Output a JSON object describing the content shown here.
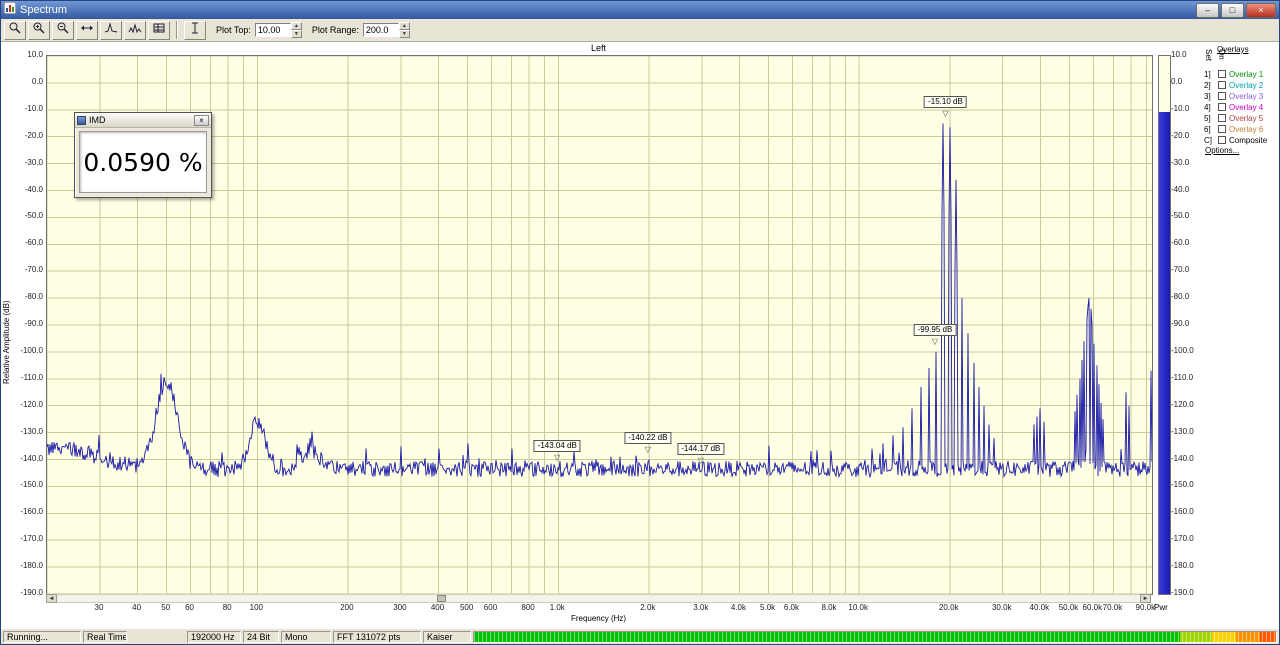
{
  "window": {
    "title": "Spectrum"
  },
  "toolbar": {
    "plot_top_label": "Plot Top:",
    "plot_top_value": "10.00",
    "plot_range_label": "Plot Range:",
    "plot_range_value": "200.0"
  },
  "imd_window": {
    "title": "IMD",
    "value": "0.0590 %"
  },
  "overlays_panel": {
    "title": "Overlays",
    "col_set": "Set",
    "col_on": "On",
    "options_label": "Options...",
    "rows": [
      {
        "num": "1]",
        "label": "Overlay 1",
        "color": "#009000"
      },
      {
        "num": "2]",
        "label": "Overlay 2",
        "color": "#00a0b0"
      },
      {
        "num": "3]",
        "label": "Overlay 3",
        "color": "#8a5fd6"
      },
      {
        "num": "4]",
        "label": "Overlay 4",
        "color": "#cc00cc"
      },
      {
        "num": "5]",
        "label": "Overlay 5",
        "color": "#b04040"
      },
      {
        "num": "6]",
        "label": "Overlay 6",
        "color": "#c08030"
      },
      {
        "num": "C]",
        "label": "Composite",
        "color": "#000000"
      }
    ]
  },
  "meter": {
    "label": "Pwr",
    "value_db": -11
  },
  "markers": [
    {
      "label": "-15.10 dB",
      "freq": 19500,
      "db": -15.1
    },
    {
      "label": "-99.95 dB",
      "freq": 18000,
      "db": -99.95
    },
    {
      "label": "-143.04 dB",
      "freq": 1000,
      "db": -143.04
    },
    {
      "label": "-140.22 dB",
      "freq": 2000,
      "db": -140.22
    },
    {
      "label": "-144.17 dB",
      "freq": 3000,
      "db": -144.17
    }
  ],
  "status_bar": {
    "items": [
      "Running...",
      "Real Time",
      "192000 Hz",
      "24 Bit",
      "Mono",
      "FFT 131072 pts",
      "Kaiser"
    ]
  },
  "chart_data": {
    "type": "line",
    "title": "Left",
    "xlabel": "Frequency (Hz)",
    "ylabel": "Relative Amplitude (dB)",
    "xscale": "log",
    "xlim": [
      20,
      94000
    ],
    "ylim": [
      -190,
      10
    ],
    "grid": true,
    "bg_color": "#ffffe4",
    "grid_color": "#c9c99c",
    "trace_color": "#1a1aa8",
    "yticks": [
      10,
      0,
      -10,
      -20,
      -30,
      -40,
      -50,
      -60,
      -70,
      -80,
      -90,
      -100,
      -110,
      -120,
      -130,
      -140,
      -150,
      -160,
      -170,
      -180,
      -190
    ],
    "xticks": [
      [
        30,
        "30"
      ],
      [
        40,
        "40"
      ],
      [
        50,
        "50"
      ],
      [
        60,
        "60"
      ],
      [
        80,
        "80"
      ],
      [
        100,
        "100"
      ],
      [
        200,
        "200"
      ],
      [
        300,
        "300"
      ],
      [
        400,
        "400"
      ],
      [
        500,
        "500"
      ],
      [
        600,
        "600"
      ],
      [
        800,
        "800"
      ],
      [
        1000,
        "1.0k"
      ],
      [
        2000,
        "2.0k"
      ],
      [
        3000,
        "3.0k"
      ],
      [
        4000,
        "4.0k"
      ],
      [
        5000,
        "5.0k"
      ],
      [
        6000,
        "6.0k"
      ],
      [
        8000,
        "8.0k"
      ],
      [
        10000,
        "10.0k"
      ],
      [
        20000,
        "20.0k"
      ],
      [
        30000,
        "30.0k"
      ],
      [
        40000,
        "40.0k"
      ],
      [
        50000,
        "50.0k"
      ],
      [
        60000,
        "60.0k"
      ],
      [
        70000,
        "70.0k"
      ],
      [
        90000,
        "90.0k"
      ]
    ],
    "noise_floor": {
      "base_db": -143.5,
      "jitter_db": 6,
      "bumps": [
        [
          22,
          8,
          0.12
        ],
        [
          50,
          33,
          0.035
        ],
        [
          100,
          17,
          0.027
        ],
        [
          150,
          7,
          0.03
        ]
      ]
    },
    "peaks": [
      [
        150,
        -132
      ],
      [
        300,
        -135
      ],
      [
        400,
        -136
      ],
      [
        500,
        -134
      ],
      [
        700,
        -136
      ],
      [
        1000,
        -143.04
      ],
      [
        1500,
        -139
      ],
      [
        2000,
        -140.22
      ],
      [
        3000,
        -144.17
      ],
      [
        5000,
        -141
      ],
      [
        7000,
        -140
      ],
      [
        11000,
        -136
      ],
      [
        12000,
        -134
      ],
      [
        13000,
        -131
      ],
      [
        14000,
        -128
      ],
      [
        15000,
        -121
      ],
      [
        16000,
        -113
      ],
      [
        17000,
        -106
      ],
      [
        18000,
        -99.95
      ],
      [
        19000,
        -15.1
      ],
      [
        20000,
        -16.5
      ],
      [
        21000,
        -36
      ],
      [
        22000,
        -80
      ],
      [
        23000,
        -93
      ],
      [
        24000,
        -104
      ],
      [
        25000,
        -113
      ],
      [
        26000,
        -120
      ],
      [
        27000,
        -127
      ],
      [
        28000,
        -132
      ],
      [
        38000,
        -127
      ],
      [
        39000,
        -124
      ],
      [
        40000,
        -121
      ],
      [
        41000,
        -126
      ],
      [
        52000,
        -122
      ],
      [
        53000,
        -116
      ],
      [
        54000,
        -110
      ],
      [
        55000,
        -103
      ],
      [
        56000,
        -96
      ],
      [
        57000,
        -88
      ],
      [
        57600,
        -83
      ],
      [
        58200,
        -80
      ],
      [
        58800,
        -84
      ],
      [
        59500,
        -90
      ],
      [
        60500,
        -97
      ],
      [
        61500,
        -105
      ],
      [
        62500,
        -112
      ],
      [
        63500,
        -119
      ],
      [
        64500,
        -125
      ],
      [
        77000,
        -115
      ],
      [
        79000,
        -120
      ],
      [
        93500,
        -107
      ]
    ],
    "power_bar_db": -11
  }
}
